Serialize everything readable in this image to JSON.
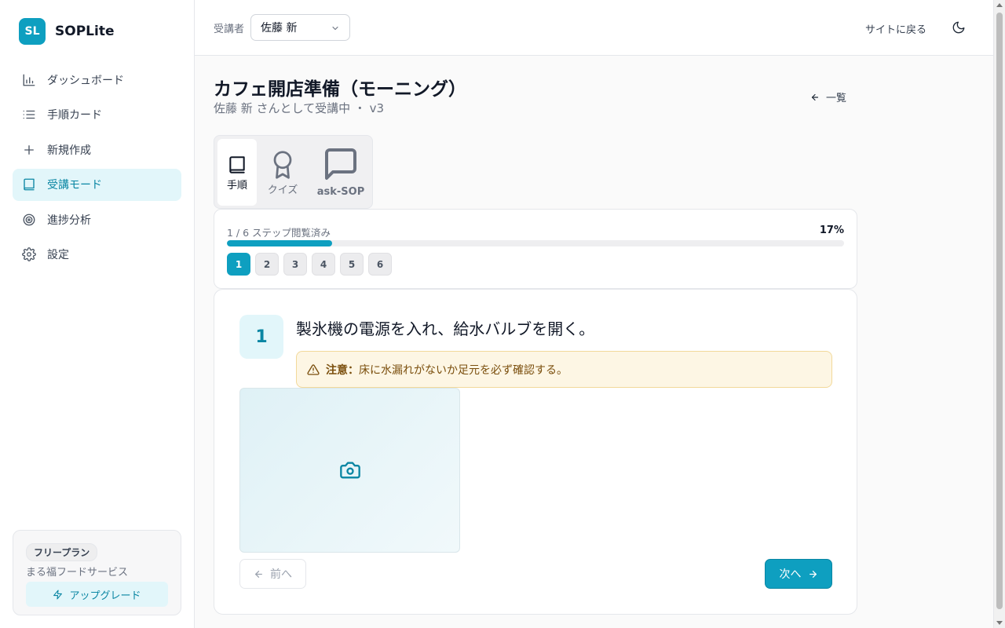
{
  "app": {
    "logo_text": "SL",
    "name": "SOPLite"
  },
  "sidebar": {
    "items": [
      {
        "label": "ダッシュボード",
        "icon": "bar-chart-icon"
      },
      {
        "label": "手順カード",
        "icon": "list-icon"
      },
      {
        "label": "新規作成",
        "icon": "plus-icon"
      },
      {
        "label": "受講モード",
        "icon": "book-icon",
        "active": true
      },
      {
        "label": "進捗分析",
        "icon": "target-icon"
      },
      {
        "label": "設定",
        "icon": "gear-icon"
      }
    ],
    "plan": {
      "badge": "フリープラン",
      "org": "まる福フードサービス",
      "upgrade_label": "アップグレード"
    }
  },
  "header": {
    "learner_label": "受講者",
    "learner_value": "佐藤 新",
    "back_to_site": "サイトに戻る"
  },
  "page": {
    "title": "カフェ開店準備（モーニング）",
    "subtitle": "佐藤 新 さんとして受講中 ・ v3",
    "list_link": "一覧"
  },
  "tabs": [
    {
      "label": "手順",
      "icon": "book-icon",
      "active": true
    },
    {
      "label": "クイズ",
      "icon": "award-icon"
    },
    {
      "label": "ask-SOP",
      "icon": "message-square-icon"
    }
  ],
  "progress": {
    "text": "1 / 6 ステップ閲覧済み",
    "percent_label": "17%",
    "percent": 17,
    "steps": [
      "1",
      "2",
      "3",
      "4",
      "5",
      "6"
    ],
    "current_step": 1
  },
  "step": {
    "number": "1",
    "text": "製氷機の電源を入れ、給水バルブを開く。",
    "caution_label": "注意：",
    "caution_text": "床に水漏れがないか足元を必ず確認する。",
    "photo_icon": "camera-icon",
    "prev_label": "前へ",
    "next_label": "次へ"
  },
  "colors": {
    "accent": "#0e9fc0",
    "accent_light": "#e2f6fa",
    "caution_bg": "#fdf6e4",
    "caution_text": "#7a4e0c"
  }
}
